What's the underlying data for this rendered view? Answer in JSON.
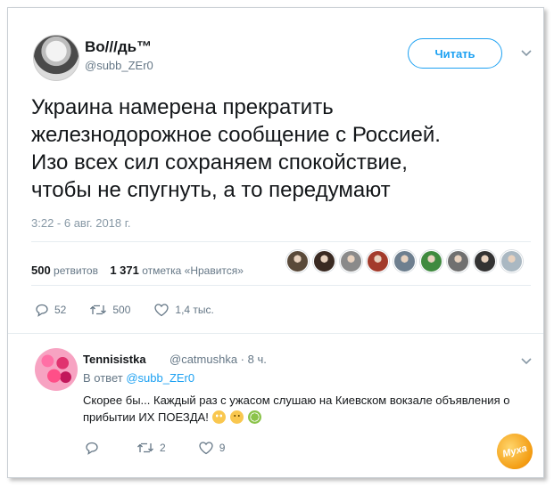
{
  "tweet": {
    "display_name": "Во///дь™",
    "handle": "@subb_ZEr0",
    "follow_label": "Читать",
    "text_lines": [
      "Украина намерена прекратить",
      "железнодорожное сообщение с Россией.",
      "Изо всех сил сохраняем спокойствие,",
      "чтобы не спугнуть, а то передумают"
    ],
    "timestamp": "3:22 - 6 авг. 2018 г.",
    "retweets_count": "500",
    "retweets_label": "ретвитов",
    "likes_count": "1 371",
    "likes_label": "отметка «Нравится»",
    "likers": [
      "#5a4a3a",
      "#3a2a22",
      "#8a8a8a",
      "#a33b2b",
      "#6e7f8f",
      "#3f8a3f",
      "#707070",
      "#333333",
      "#aab8c2"
    ],
    "actions": {
      "replies": "52",
      "retweets": "500",
      "likes": "1,4 тыс."
    }
  },
  "reply": {
    "display_name": "Tennisistka",
    "handle_time": "@catmushka · 8 ч.",
    "reply_to_prefix": "В ответ",
    "reply_to_handle": "@subb_ZEr0",
    "text_line1": "Скорее бы... Каждый раз с ужасом слушаю на Киевском вокзале объявления о",
    "text_line2": "прибытии ИХ ПОЕЗДА!",
    "actions": {
      "replies": "",
      "retweets": "2",
      "likes": "9"
    }
  },
  "watermark": {
    "text": "Муха"
  },
  "colors": {
    "accent": "#1da1f2",
    "muted": "#657786",
    "text": "#14171a"
  }
}
